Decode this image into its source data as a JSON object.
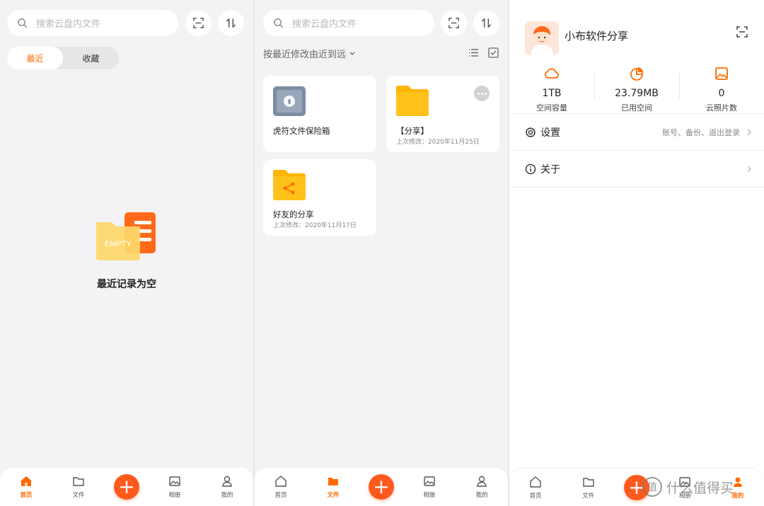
{
  "search": {
    "placeholder": "搜索云盘内文件"
  },
  "home": {
    "tabs": [
      "最近",
      "收藏"
    ],
    "active_tab": "最近",
    "empty_badge": "EMPTY",
    "empty_text": "最近记录为空"
  },
  "files": {
    "sort_label": "按最近修改由近到远",
    "items": [
      {
        "name": "虎符文件保险箱",
        "date": ""
      },
      {
        "name": "【分享】",
        "date": "上次修改：2020年11月25日"
      },
      {
        "name": "好友的分享",
        "date": "上次修改：2020年11月17日"
      }
    ]
  },
  "profile": {
    "username": "小布软件分享",
    "stats": [
      {
        "value": "1TB",
        "label": "空间容量"
      },
      {
        "value": "23.79MB",
        "label": "已用空间"
      },
      {
        "value": "0",
        "label": "云照片数"
      }
    ],
    "settings_label": "设置",
    "settings_hint": "账号、备份、退出登录",
    "about_label": "关于"
  },
  "tabbar": {
    "items": [
      "首页",
      "文件",
      "相册",
      "我的"
    ]
  },
  "plus_label": "+",
  "watermark": {
    "text": "什么值得买",
    "badge": "值"
  },
  "colors": {
    "accent": "#ff6a00",
    "plus": "#ff5a1e",
    "folder": "#ffc21a",
    "background": "#f3f3f5"
  }
}
